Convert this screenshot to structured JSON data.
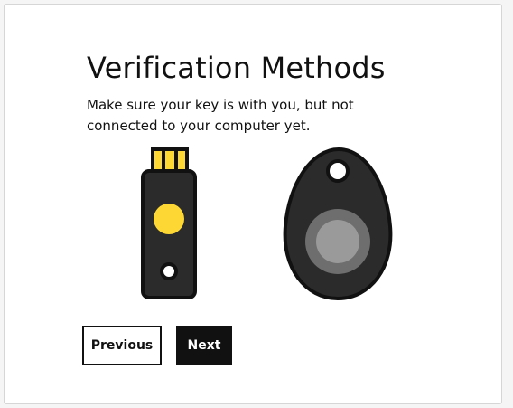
{
  "page": {
    "title": "Verification Methods",
    "description": "Make sure your key is with you, but not connected to your computer yet."
  },
  "buttons": {
    "previous_label": "Previous",
    "next_label": "Next"
  },
  "illustration": {
    "items": [
      "usb-security-key-icon",
      "keyfob-security-key-icon"
    ],
    "colors": {
      "key_body": "#2b2b2b",
      "key_outline": "#111111",
      "accent_yellow": "#fdd835",
      "fob_button_outer": "#6e6e6e",
      "fob_button_inner": "#9a9a9a"
    }
  },
  "theme": {
    "primary_button_bg": "#111111",
    "primary_button_text": "#ffffff",
    "secondary_button_border": "#111111"
  }
}
